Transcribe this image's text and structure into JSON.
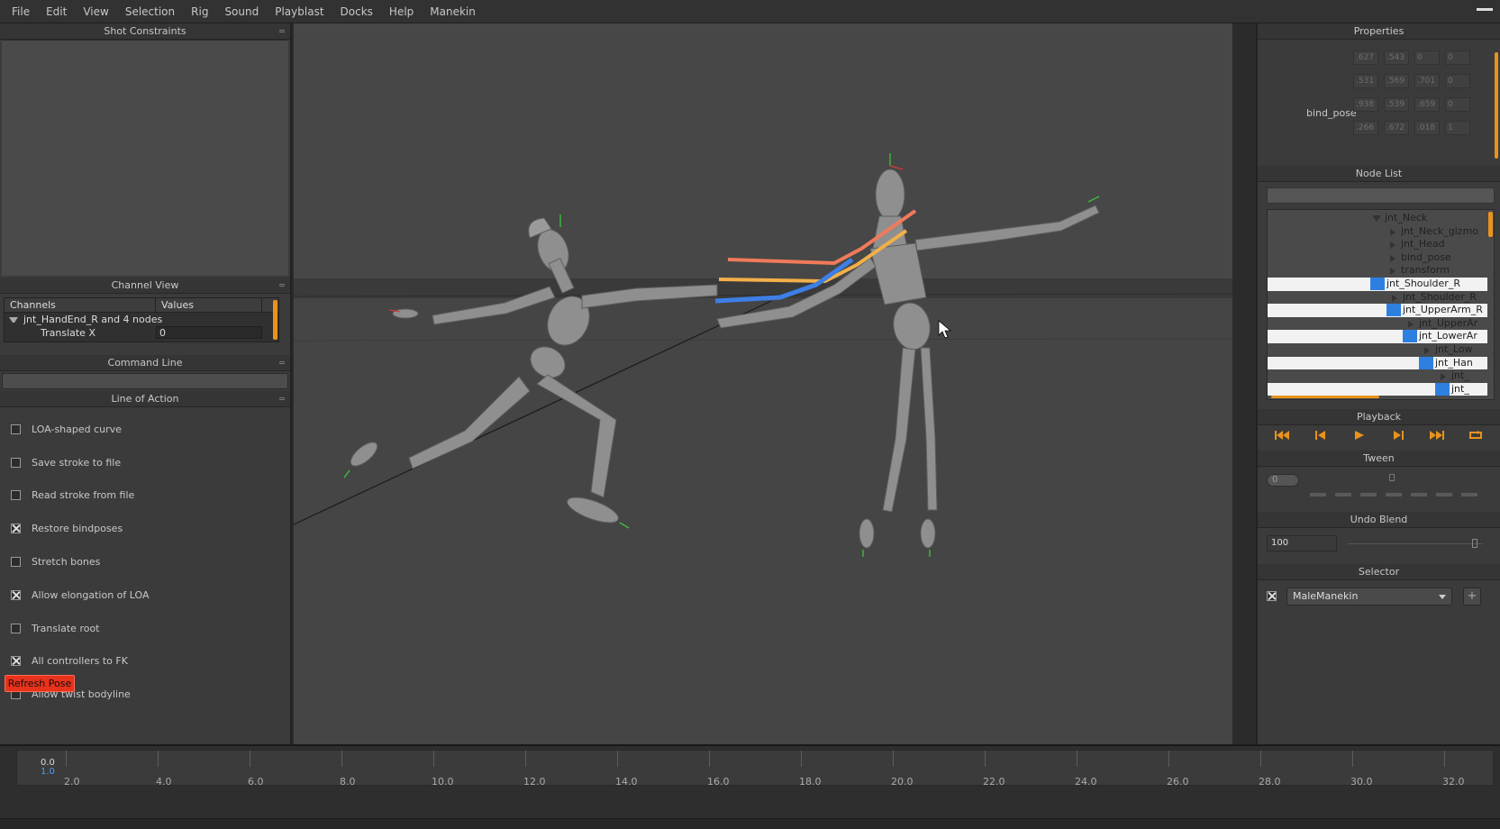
{
  "menubar": {
    "items": [
      "File",
      "Edit",
      "View",
      "Selection",
      "Rig",
      "Sound",
      "Playblast",
      "Docks",
      "Help",
      "Manekin"
    ]
  },
  "left_panel": {
    "shot_constraints_title": "Shot Constraints",
    "channel_view": {
      "title": "Channel View",
      "col_channels": "Channels",
      "col_values": "Values",
      "group_label": "jnt_HandEnd_R and 4 nodes",
      "channel_label": "Translate X",
      "channel_value": "0"
    },
    "command_line_title": "Command Line",
    "line_of_action": {
      "title": "Line of Action",
      "options": [
        {
          "label": "LOA-shaped curve",
          "checked": false
        },
        {
          "label": "Save stroke to file",
          "checked": false
        },
        {
          "label": "Read stroke from file",
          "checked": false
        },
        {
          "label": "Restore bindposes",
          "checked": true
        },
        {
          "label": "Stretch bones",
          "checked": false
        },
        {
          "label": "Allow elongation of LOA",
          "checked": true
        },
        {
          "label": "Translate root",
          "checked": false
        },
        {
          "label": "All controllers to FK",
          "checked": true
        },
        {
          "label": "Allow twist bodyline",
          "checked": false
        }
      ],
      "refresh_label": "Refresh Pose"
    }
  },
  "right_panel": {
    "properties_title": "Properties",
    "bind_pose_label": "bind_pose",
    "matrix": [
      [
        ".627",
        ".543",
        "0",
        "0"
      ],
      [
        ".531",
        ".569",
        ".701",
        "0"
      ],
      [
        ".938",
        ".539",
        ".659",
        "0"
      ],
      [
        ".266",
        ".672",
        ".018",
        "1"
      ]
    ],
    "node_list_title": "Node List",
    "nodes": [
      {
        "label": "jnt_Neck",
        "arrow": "down-grey",
        "selected": false
      },
      {
        "label": "jnt_Neck_gizmo",
        "arrow": "right",
        "selected": false
      },
      {
        "label": "jnt_Head",
        "arrow": "right",
        "selected": false
      },
      {
        "label": "bind_pose",
        "arrow": "right",
        "selected": false
      },
      {
        "label": "transform",
        "arrow": "right",
        "selected": false
      },
      {
        "label": "jnt_Shoulder_R",
        "arrow": "down",
        "selected": true
      },
      {
        "label": "jnt_Shoulder_R",
        "arrow": "right",
        "selected": false
      },
      {
        "label": "jnt_UpperArm_R",
        "arrow": "down",
        "selected": true
      },
      {
        "label": "jnt_UpperAr",
        "arrow": "right",
        "selected": false
      },
      {
        "label": "jnt_LowerAr",
        "arrow": "down",
        "selected": true
      },
      {
        "label": "jnt_Low",
        "arrow": "right",
        "selected": false
      },
      {
        "label": "jnt_Han",
        "arrow": "down",
        "selected": true
      },
      {
        "label": "jnt_",
        "arrow": "right",
        "selected": false
      },
      {
        "label": "jnt_",
        "arrow": "right-blue",
        "selected": true
      }
    ],
    "playback_title": "Playback",
    "tween_title": "Tween",
    "tween_value": "0",
    "undo_blend_title": "Undo Blend",
    "undo_blend_value": "100",
    "selector_title": "Selector",
    "selector_value": "MaleManekin",
    "selector_checked": true,
    "selector_add": "+"
  },
  "timeline": {
    "current_a": "0.0",
    "current_b": "1.0",
    "labels": [
      "2.0",
      "4.0",
      "6.0",
      "8.0",
      "10.0",
      "12.0",
      "14.0",
      "16.0",
      "18.0",
      "20.0",
      "22.0",
      "24.0",
      "26.0",
      "28.0",
      "30.0",
      "32.0"
    ]
  },
  "colors": {
    "accent_orange": "#e8931c",
    "refresh_red": "#e8321c",
    "select_blue": "#2e80e0",
    "curve_salmon": "#f07a5a",
    "curve_yellow": "#f2b04a",
    "curve_blue": "#3d7fe6"
  }
}
